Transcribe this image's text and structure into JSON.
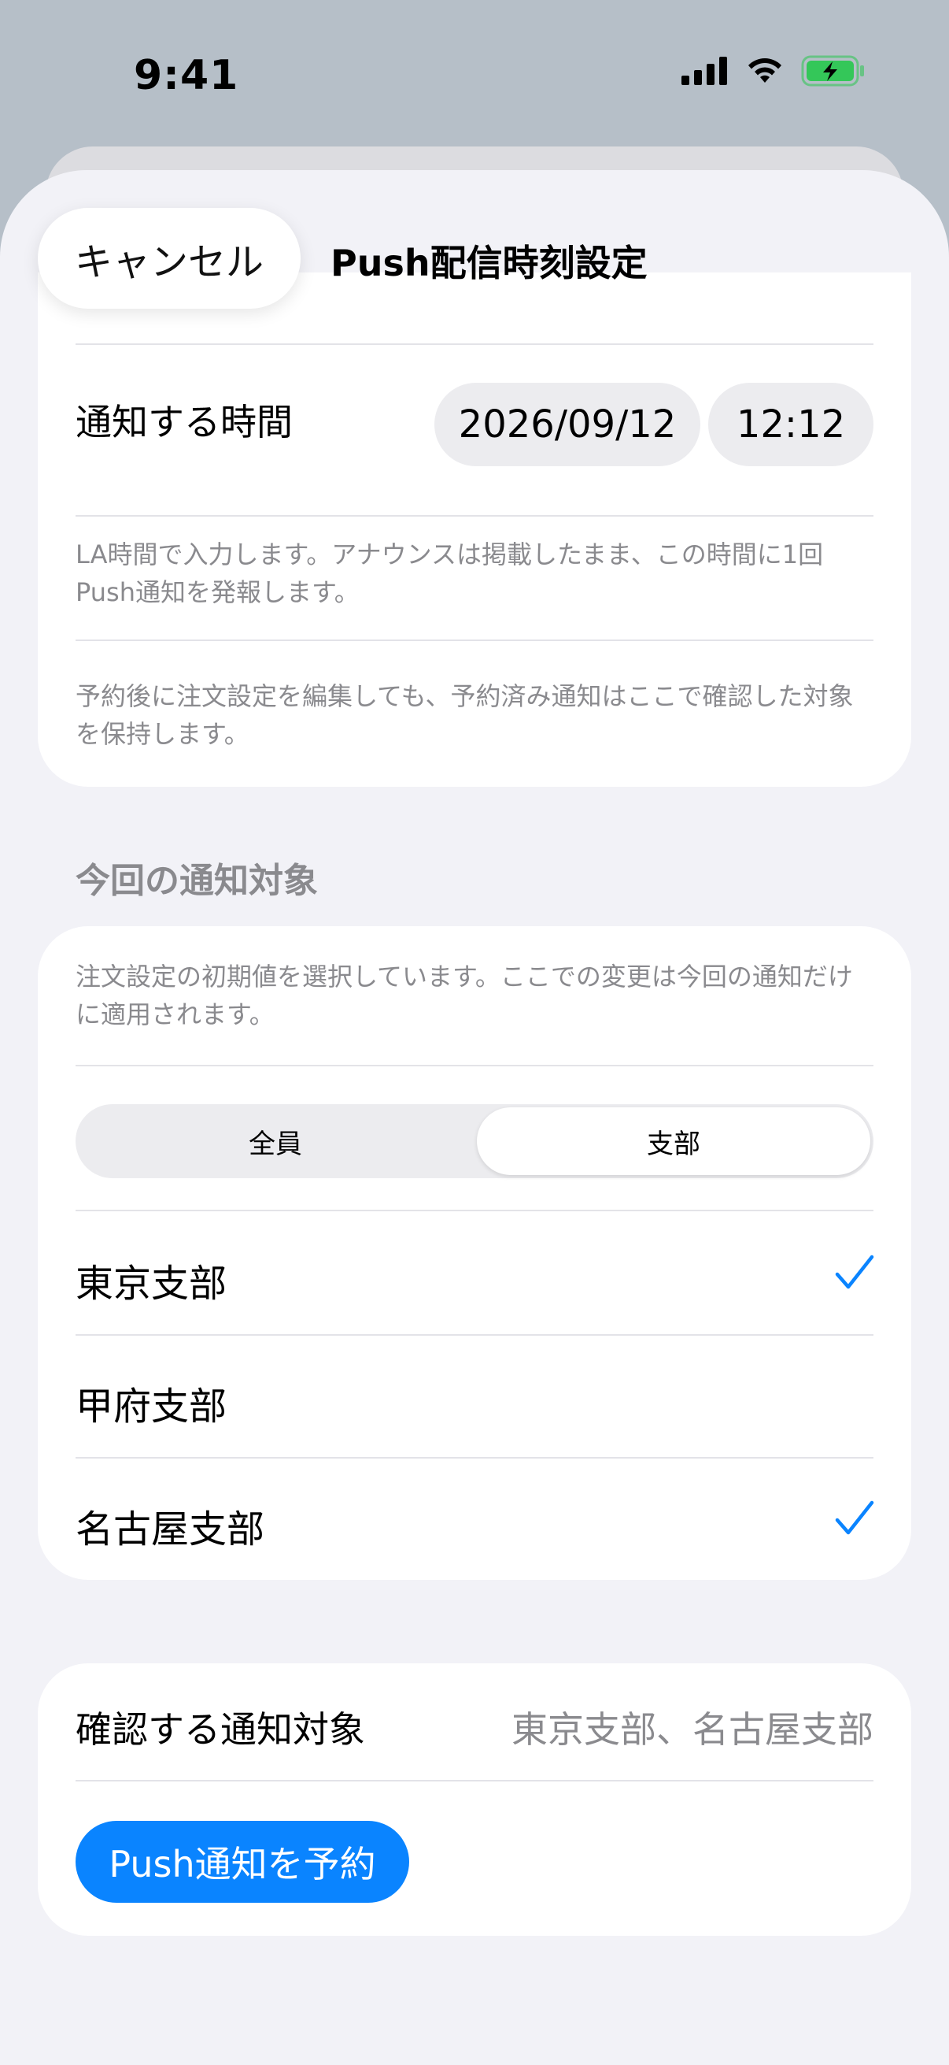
{
  "status_bar": {
    "time": "9:41",
    "icons": [
      "signal-icon",
      "wifi-icon",
      "battery-charging-icon"
    ],
    "battery_color": "#34c759"
  },
  "header": {
    "cancel_label": "キャンセル",
    "title": "Push配信時刻設定"
  },
  "schedule": {
    "label": "通知する時間",
    "date": "2026/09/12",
    "time": "12:12",
    "note_1": "LA時間で入力します。アナウンスは掲載したまま、この時間に1回Push通知を発報します。",
    "note_2": "予約後に注文設定を編集しても、予約済み通知はここで確認した対象を保持します。"
  },
  "targets": {
    "section_title": "今回の通知対象",
    "note": "注文設定の初期値を選択しています。ここでの変更は今回の通知だけに適用されます。",
    "segments": [
      "全員",
      "支部"
    ],
    "selected_segment": "支部",
    "branches": [
      {
        "label": "東京支部",
        "checked": true
      },
      {
        "label": "甲府支部",
        "checked": false
      },
      {
        "label": "名古屋支部",
        "checked": true
      }
    ],
    "check_color": "#0a84ff"
  },
  "confirm": {
    "label": "確認する通知対象",
    "value": "東京支部、名古屋支部",
    "button_label": "Push通知を予約",
    "button_color": "#0a84ff"
  }
}
